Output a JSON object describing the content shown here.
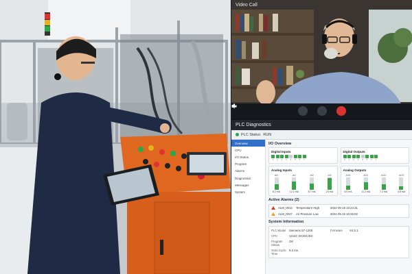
{
  "video": {
    "title": "Video Call"
  },
  "plc": {
    "title": "PLC Diagnostics",
    "status_label": "PLC Status:",
    "status_value": "RUN",
    "sidebar": [
      "Overview",
      "CPU",
      "I/O Status",
      "Program",
      "Alarms",
      "Diagnostics",
      "Messages",
      "System"
    ],
    "overview_title": "I/O Overview",
    "digital_inputs": {
      "title": "Digital Inputs",
      "bits": [
        1,
        1,
        1,
        1,
        0,
        1,
        1,
        1
      ],
      "labels": [
        "0",
        "1",
        "2",
        "3",
        "4",
        "5",
        "6",
        "7"
      ]
    },
    "digital_outputs": {
      "title": "Digital Outputs",
      "bits": [
        1,
        1,
        1,
        1,
        0,
        1,
        1,
        1
      ],
      "labels": [
        "0",
        "1",
        "2",
        "3",
        "4",
        "5",
        "6",
        "7"
      ]
    },
    "analog_inputs": {
      "title": "Analog Inputs",
      "channels": [
        {
          "label": "AI0",
          "value": "8.2 mA",
          "level": 0.45
        },
        {
          "label": "AI1",
          "value": "12.1 mA",
          "level": 0.65
        },
        {
          "label": "AI2",
          "value": "8.7 mA",
          "level": 0.48
        },
        {
          "label": "AI3",
          "value": "24 mA",
          "level": 0.95
        }
      ]
    },
    "analog_outputs": {
      "title": "Analog Outputs",
      "channels": [
        {
          "label": "AO0",
          "value": "6.0 mA",
          "level": 0.35
        },
        {
          "label": "AO1",
          "value": "11.2 mA",
          "level": 0.6
        },
        {
          "label": "AO2",
          "value": "7.2 mA",
          "level": 0.42
        },
        {
          "label": "AO3",
          "value": "4.8 mA",
          "level": 0.28
        }
      ]
    },
    "alarms": {
      "title": "Active Alarms (2)",
      "rows": [
        {
          "id": "ALM_0012",
          "desc": "Temperature High",
          "time": "2024-05-16 10:24:31",
          "severity": "high"
        },
        {
          "id": "ALM_0047",
          "desc": "Air Pressure Low",
          "time": "2024-05-16 10:25:02",
          "severity": "warn"
        }
      ]
    },
    "system": {
      "title": "System Information",
      "rows": [
        {
          "k": "PLC Model",
          "v": "Siemens S7-1200",
          "k2": "Firmware",
          "v2": "V4.5.1"
        },
        {
          "k": "CPU",
          "v": "1214C DC/DC/DC",
          "k2": "",
          "v2": ""
        },
        {
          "k": "Program Status",
          "v": "OK",
          "k2": "",
          "v2": ""
        },
        {
          "k": "Scan Cycle Time",
          "v": "8.2 ms",
          "k2": "",
          "v2": ""
        }
      ]
    }
  },
  "colors": {
    "panel_orange": "#e0671f",
    "status_green": "#29a745",
    "alarm_red": "#d93434",
    "accent_blue": "#2f6fc7"
  }
}
